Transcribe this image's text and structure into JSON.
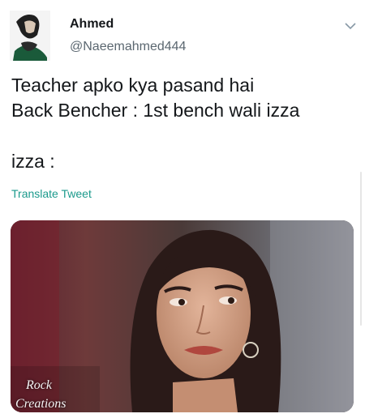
{
  "tweet": {
    "author_name": "Ahmed",
    "author_handle": "@Naeemahmed444",
    "lines": [
      "Teacher apko kya pasand hai",
      "Back Bencher : 1st bench wali izza",
      "izza :"
    ],
    "translate_label": "Translate Tweet",
    "menu_icon": "chevron-down-icon",
    "avatar_icon": "avatar"
  },
  "media": {
    "watermark_line1": "Rock",
    "watermark_line2": "Creations"
  },
  "colors": {
    "text": "#14171a",
    "secondary": "#5b6770",
    "link": "#1b9a8c"
  }
}
